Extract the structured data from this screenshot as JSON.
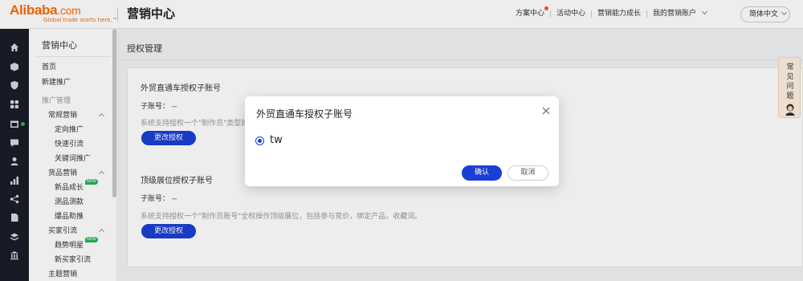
{
  "header": {
    "logo_brand": "Alibaba",
    "logo_suffix": ".com",
    "logo_tagline": "Global trade starts here.™",
    "app_title": "营销中心",
    "nav": [
      "方案中心",
      "活动中心",
      "营销能力成长",
      "我的营销账户"
    ],
    "lang": "简体中文"
  },
  "rail": {
    "icons": [
      "home-icon",
      "box-icon",
      "shield-icon",
      "grid-icon",
      "calendar-icon",
      "chat-icon",
      "user-icon",
      "bar-chart-icon",
      "share-icon",
      "document-icon",
      "layers-icon",
      "bank-icon"
    ]
  },
  "sidebar": {
    "title": "营销中心",
    "home": "首页",
    "new_promo": "新建推广",
    "group_label": "推广管理",
    "regular": "常规营销",
    "targeted": "定向推广",
    "quick": "快速引流",
    "keyword": "关键词推广",
    "product": "货品营销",
    "new_product": "新品成长",
    "test_product": "测品测款",
    "hot_product": "爆品助推",
    "buyer": "买家引流",
    "trend": "趋势明星",
    "new_buyer": "新买家引流",
    "theme": "主题营销",
    "new_badge": "NEW"
  },
  "main": {
    "page_title": "授权管理",
    "section1": {
      "title": "外贸直通车授权子账号",
      "account_label": "子账号：",
      "account_value": "--",
      "desc": "系统支持授权一个\"制作员\"类型的",
      "button": "更改授权"
    },
    "section2": {
      "title": "顶级展位授权子账号",
      "account_label": "子账号：",
      "account_value": "--",
      "desc": "系统支持授权一个\"制作员账号\"全权操作顶级展位，包括参与竞价，绑定产品，收藏词。",
      "button": "更改授权"
    }
  },
  "help": {
    "label": "常见问题"
  },
  "modal": {
    "title": "外贸直通车授权子账号",
    "option": "tw",
    "ok": "确认",
    "cancel": "取消"
  },
  "colors": {
    "primary": "#1a3fd4",
    "brand": "#ff6a00",
    "rail_bg": "#1a1d28",
    "new_badge": "#1db954"
  }
}
